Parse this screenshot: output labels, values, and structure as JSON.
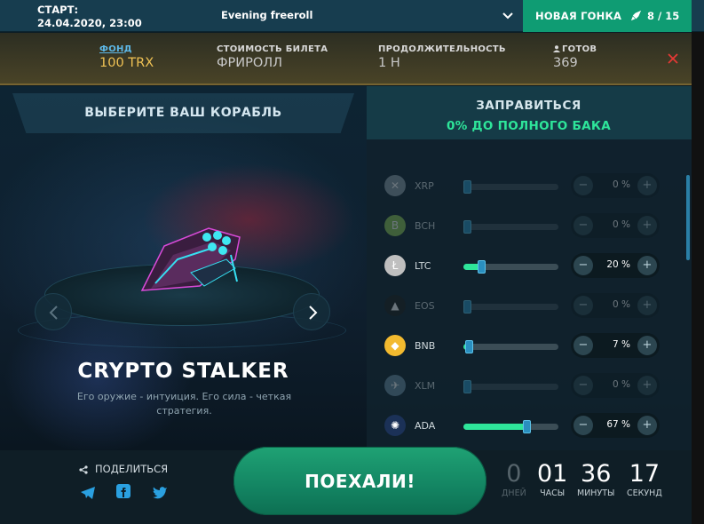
{
  "topbar": {
    "start_label": "СТАРТ:",
    "start_date": "24.04.2020, 23:00",
    "race_name": "Evening freeroll",
    "new_race_label": "НОВАЯ ГОНКА",
    "race_count": "8 / 15"
  },
  "info": {
    "fund_label": "ФОНД",
    "fund_value": "100 TRX",
    "ticket_label": "СТОИМОСТЬ БИЛЕТА",
    "ticket_value": "ФРИРОЛЛ",
    "duration_label": "ПРОДОЛЖИТЕЛЬНОСТЬ",
    "duration_value": "1 H",
    "ready_label": "ГОТОВ",
    "ready_value": "369"
  },
  "ship": {
    "header": "ВЫБЕРИТЕ ВАШ КОРАБЛЬ",
    "name": "CRYPTO STALKER",
    "description": "Его оружие - интуиция. Его сила - четкая стратегия."
  },
  "fuel": {
    "header": "ЗАПРАВИТЬСЯ",
    "status": "0% ДО ПОЛНОГО БАКА",
    "coins": [
      {
        "name": "XRP",
        "percent": "0 %",
        "value": 0,
        "active": false,
        "color": "#8a9aa3",
        "icon": "xrp-icon"
      },
      {
        "name": "BCH",
        "percent": "0 %",
        "value": 0,
        "active": false,
        "color": "#8dc351",
        "icon": "bch-icon"
      },
      {
        "name": "LTC",
        "percent": "20 %",
        "value": 20,
        "active": true,
        "color": "#bfbfbf",
        "icon": "ltc-icon"
      },
      {
        "name": "EOS",
        "percent": "0 %",
        "value": 0,
        "active": false,
        "color": "#1c1c1c",
        "icon": "eos-icon"
      },
      {
        "name": "BNB",
        "percent": "7 %",
        "value": 7,
        "active": true,
        "color": "#f3ba2f",
        "icon": "bnb-icon"
      },
      {
        "name": "XLM",
        "percent": "0 %",
        "value": 0,
        "active": false,
        "color": "#6a8aa0",
        "icon": "xlm-icon"
      },
      {
        "name": "ADA",
        "percent": "67 %",
        "value": 67,
        "active": true,
        "color": "#1b3157",
        "icon": "ada-icon"
      }
    ]
  },
  "bottom": {
    "share_label": "ПОДЕЛИТЬСЯ",
    "go_label": "ПОЕХАЛИ!",
    "timer": [
      {
        "value": "0",
        "label": "ДНЕЙ"
      },
      {
        "value": "01",
        "label": "ЧАСЫ"
      },
      {
        "value": "36",
        "label": "МИНУТЫ"
      },
      {
        "value": "17",
        "label": "СЕКУНД"
      }
    ]
  },
  "colors": {
    "accent_green": "#2ee59a",
    "button_green": "#0f9c73",
    "fund_gold": "#f0c254",
    "link_blue": "#5db7e6",
    "close_red": "#e53935"
  }
}
